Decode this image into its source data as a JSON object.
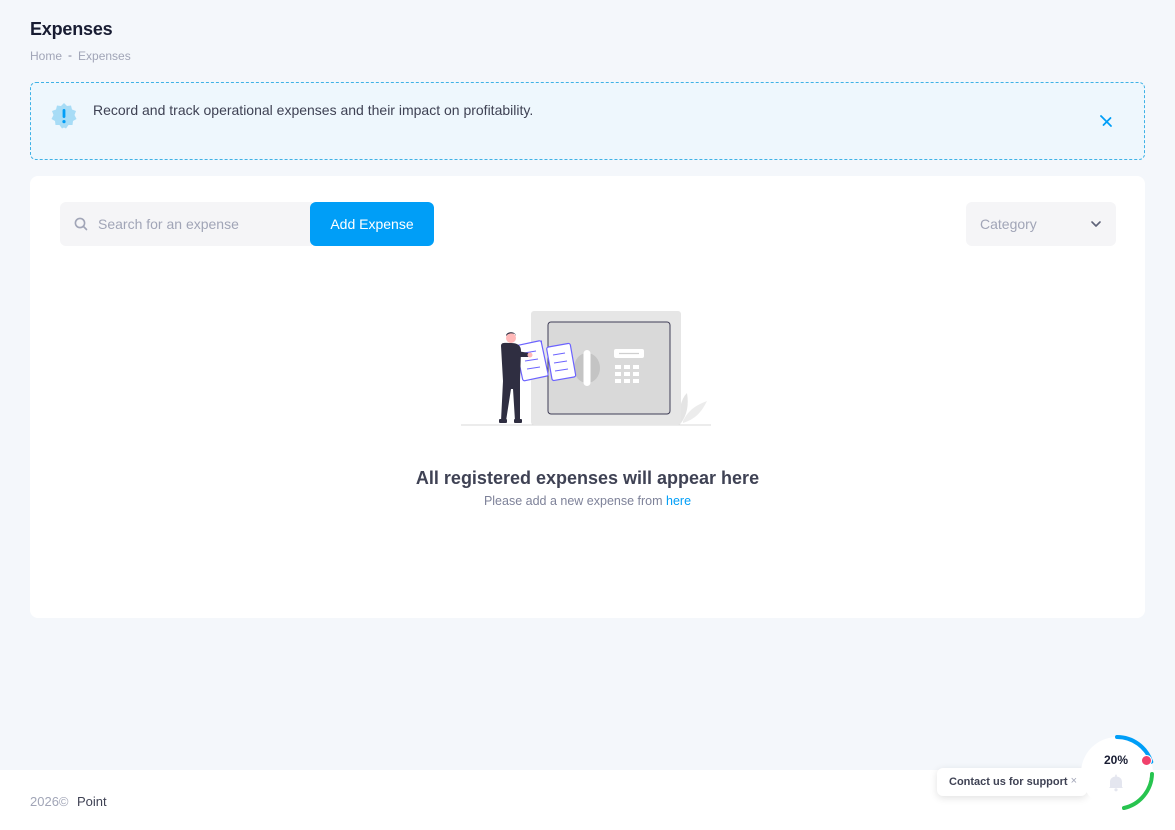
{
  "header": {
    "title": "Expenses",
    "breadcrumb": [
      "Home",
      "-",
      "Expenses"
    ]
  },
  "notice": {
    "text": "Record and track operational expenses and their impact on profitability.",
    "icon": "exclamation-badge-icon"
  },
  "toolbar": {
    "search_placeholder": "Search for an expense",
    "add_label": "Add Expense",
    "category_label": "Category"
  },
  "empty_state": {
    "title": "All registered expenses will appear here",
    "subtitle": "Please add a new expense from",
    "link": "here"
  },
  "footer": {
    "year": "2026©",
    "brand": "Point"
  },
  "support": {
    "label": "Contact us for support",
    "close": "×"
  },
  "progress": {
    "percent_label": "20%",
    "value": 0.2
  },
  "colors": {
    "primary": "#009ef7",
    "notice_border": "#3fb2e6",
    "notice_bg": "#eef7fd",
    "progress_blue": "#009ef7",
    "progress_green": "#27c44f",
    "alert_red": "#f1416c"
  }
}
